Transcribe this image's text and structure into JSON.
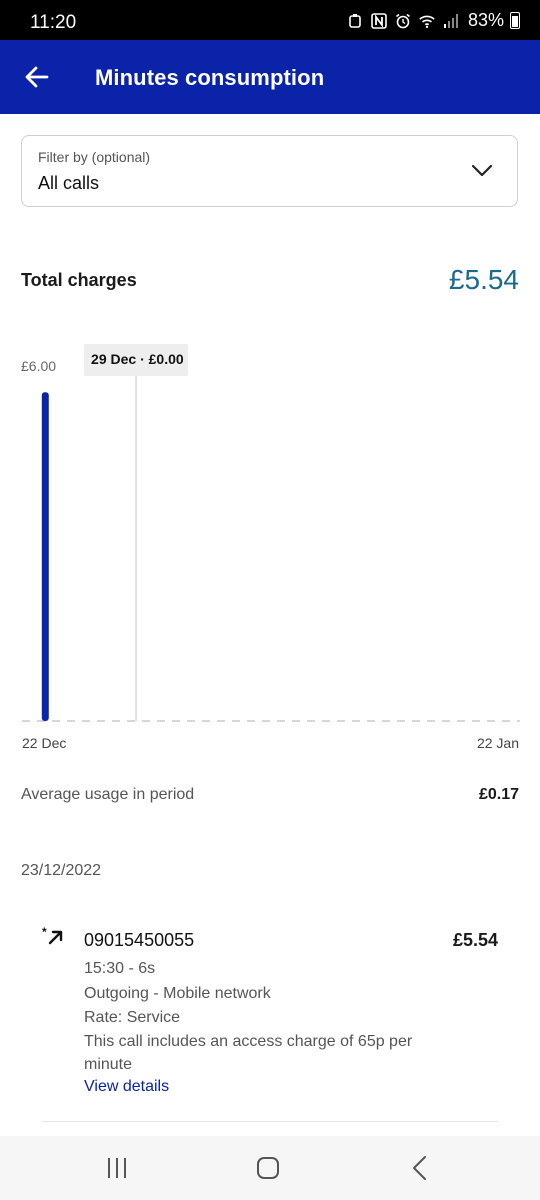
{
  "status_bar": {
    "time": "11:20",
    "battery": "83%",
    "icons": [
      "notification-icon",
      "nfc-icon",
      "alarm-icon",
      "wifi-icon",
      "signal-icon",
      "battery-icon"
    ]
  },
  "app_bar": {
    "title": "Minutes consumption",
    "back_icon": "arrow-left-icon"
  },
  "filter": {
    "label": "Filter by (optional)",
    "value": "All calls",
    "icon": "chevron-down-icon"
  },
  "total": {
    "label": "Total charges",
    "value": "£5.54",
    "color": "#1a6a8f"
  },
  "chart_data": {
    "type": "bar",
    "x_start": "22 Dec",
    "x_end": "22 Jan",
    "y_max_label": "£6.00",
    "ylim": [
      0,
      6
    ],
    "bars": [
      {
        "date": "23 Dec",
        "day_index": 1,
        "value": 5.54
      }
    ],
    "total_days": 31,
    "tooltip": {
      "label": "29 Dec · £0.00",
      "day_index": 7
    },
    "bar_color": "#0a23a8",
    "grid": false
  },
  "average": {
    "label": "Average usage in period",
    "value": "£0.17"
  },
  "date_heading": "23/12/2022",
  "call": {
    "icon": "outgoing-call-icon",
    "number": "09015450055",
    "amount": "£5.54",
    "time_duration": "15:30 - 6s",
    "type": "Outgoing - Mobile network",
    "rate": "Rate: Service",
    "note": "This call includes an access charge of 65p per minute",
    "link": "View details"
  },
  "nav": {
    "recents_icon": "recents-icon",
    "home_icon": "home-icon",
    "back_icon": "back-icon"
  },
  "colors": {
    "brand": "#0a23a8",
    "accent": "#1a6a8f"
  }
}
